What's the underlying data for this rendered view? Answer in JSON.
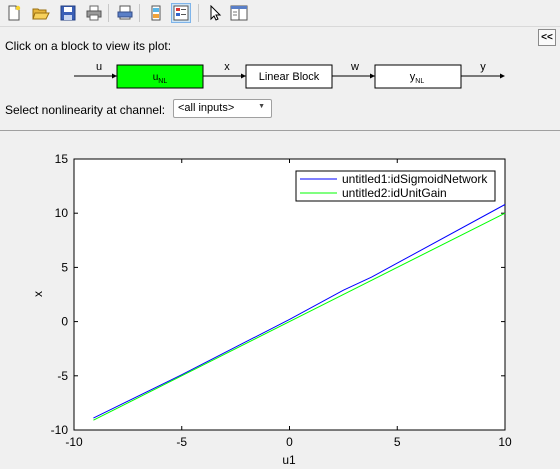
{
  "toolbar": {
    "buttons": [
      {
        "icon": "new-file-icon"
      },
      {
        "icon": "open-folder-icon"
      },
      {
        "icon": "save-icon"
      },
      {
        "icon": "print-icon"
      },
      {
        "icon": "print-preview-icon"
      },
      {
        "icon": "figure-palette-icon"
      },
      {
        "icon": "plot-browser-icon",
        "active": true
      },
      {
        "icon": "pointer-icon"
      },
      {
        "icon": "property-editor-icon"
      }
    ]
  },
  "panel": {
    "instruction": "Click on a block to view its plot:",
    "collapse_label": "<<",
    "channel_label": "Select nonlinearity at channel:",
    "channel_value": "<all inputs>",
    "signals": {
      "u": "u",
      "x": "x",
      "w": "w",
      "y": "y"
    },
    "blocks": {
      "input_nl_main": "u",
      "input_nl_sub": "NL",
      "linear": "Linear Block",
      "output_nl_main": "y",
      "output_nl_sub": "NL"
    },
    "colors": {
      "active_block": "#00ff00"
    }
  },
  "chart_data": {
    "type": "line",
    "xlabel": "u1",
    "ylabel": "x",
    "xlim": [
      -10,
      10
    ],
    "ylim": [
      -10,
      15
    ],
    "xticks": [
      -10,
      -5,
      0,
      5,
      10
    ],
    "yticks": [
      -10,
      -5,
      0,
      5,
      10,
      15
    ],
    "grid": false,
    "legend_position": "top-right",
    "series": [
      {
        "name": "untitled1:idSigmoidNetwork",
        "color": "#0000ff",
        "x": [
          -9.1,
          -5,
          0,
          2.5,
          3.8,
          5,
          10
        ],
        "y": [
          -8.9,
          -4.9,
          0.2,
          2.9,
          4.1,
          5.4,
          10.8
        ]
      },
      {
        "name": "untitled2:idUnitGain",
        "color": "#00ff00",
        "x": [
          -9.1,
          10
        ],
        "y": [
          -9.1,
          10
        ]
      }
    ]
  }
}
